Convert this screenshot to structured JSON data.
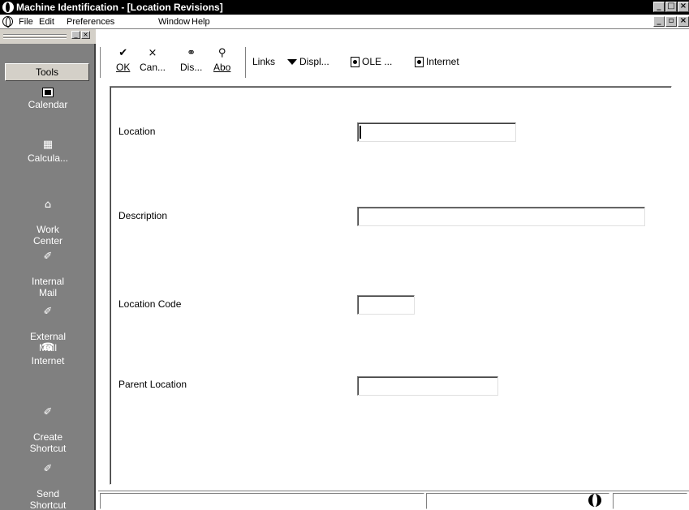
{
  "window": {
    "title": "Machine Identification - [Location Revisions]"
  },
  "menubar": {
    "items": [
      "File",
      "Edit",
      "Preferences",
      "Window",
      "Help"
    ]
  },
  "tools": {
    "header": "Tools",
    "items": [
      {
        "label": "Calendar",
        "icon": "calendar-icon"
      },
      {
        "label": "Calcula...",
        "icon": "calculator-icon"
      },
      {
        "label": "Work\nCenter",
        "icon": "work-center-icon"
      },
      {
        "label": "Internal\nMail",
        "icon": "pencil-icon"
      },
      {
        "label": "External\nMail",
        "icon": "pencil-icon"
      },
      {
        "label": "Internet",
        "icon": "phone-icon"
      },
      {
        "label": "Create\nShortcut",
        "icon": "pencil-icon"
      },
      {
        "label": "Send\nShortcut",
        "icon": "pencil-icon"
      }
    ]
  },
  "toolbar": {
    "ok": "OK",
    "cancel": "Can...",
    "display": "Dis...",
    "about": "Abo",
    "links": "Links",
    "displ": "Displ...",
    "ole": "OLE ...",
    "internet": "Internet"
  },
  "form": {
    "location_label": "Location",
    "location_value": "",
    "description_label": "Description",
    "description_value": "",
    "location_code_label": "Location Code",
    "location_code_value": "",
    "parent_location_label": "Parent Location",
    "parent_location_value": ""
  }
}
